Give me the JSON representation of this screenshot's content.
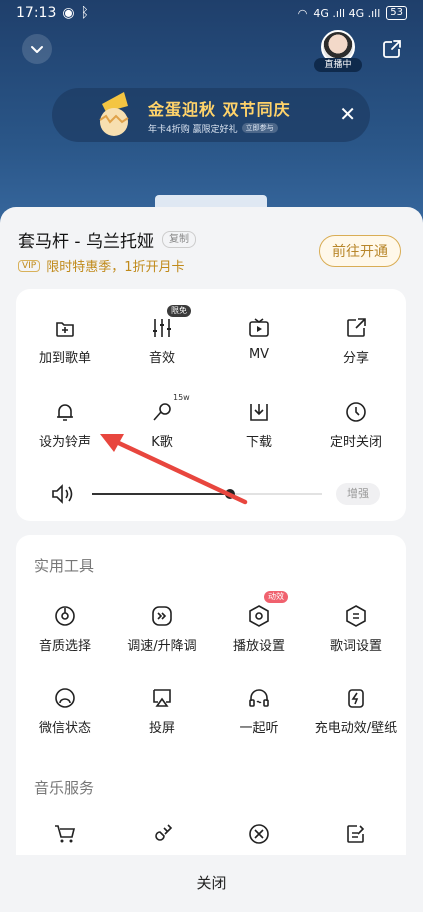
{
  "status_bar": {
    "time": "17:13",
    "signal": "4G .ıll 4G .ıll",
    "battery": "53"
  },
  "header": {
    "live_label": "直播中"
  },
  "banner": {
    "title": "金蛋迎秋 双节同庆",
    "subtitle": "年卡4折购 赢限定好礼",
    "cta": "立即参与"
  },
  "song": {
    "title": "套马杆 - 乌兰托娅",
    "copy_label": "复制",
    "vip_tag": "VIP",
    "vip_promo": "限时特惠季，1折开月卡",
    "open_button": "前往开通"
  },
  "actions": [
    {
      "label": "加到歌单",
      "icon": "add-to-playlist-icon"
    },
    {
      "label": "音效",
      "icon": "sound-effect-icon",
      "badge": "限免"
    },
    {
      "label": "MV",
      "icon": "mv-icon"
    },
    {
      "label": "分享",
      "icon": "share-icon"
    },
    {
      "label": "设为铃声",
      "icon": "bell-icon"
    },
    {
      "label": "K歌",
      "icon": "karaoke-mic-icon",
      "badge": "15w"
    },
    {
      "label": "下载",
      "icon": "download-icon"
    },
    {
      "label": "定时关闭",
      "icon": "clock-icon"
    }
  ],
  "volume": {
    "level": 0.6,
    "boost_label": "增强"
  },
  "tools": {
    "title": "实用工具",
    "items": [
      {
        "label": "音质选择",
        "icon": "quality-icon"
      },
      {
        "label": "调速/升降调",
        "icon": "speed-icon"
      },
      {
        "label": "播放设置",
        "icon": "play-settings-icon",
        "badge": "动效"
      },
      {
        "label": "歌词设置",
        "icon": "lyrics-icon"
      },
      {
        "label": "微信状态",
        "icon": "wechat-status-icon"
      },
      {
        "label": "投屏",
        "icon": "cast-icon"
      },
      {
        "label": "一起听",
        "icon": "listen-together-icon"
      },
      {
        "label": "充电动效/壁纸",
        "icon": "charging-icon"
      }
    ]
  },
  "services": {
    "title": "音乐服务"
  },
  "footer": {
    "close_label": "关闭"
  },
  "colors": {
    "accent_gold": "#b8862a",
    "arrow_red": "#e8463e"
  }
}
